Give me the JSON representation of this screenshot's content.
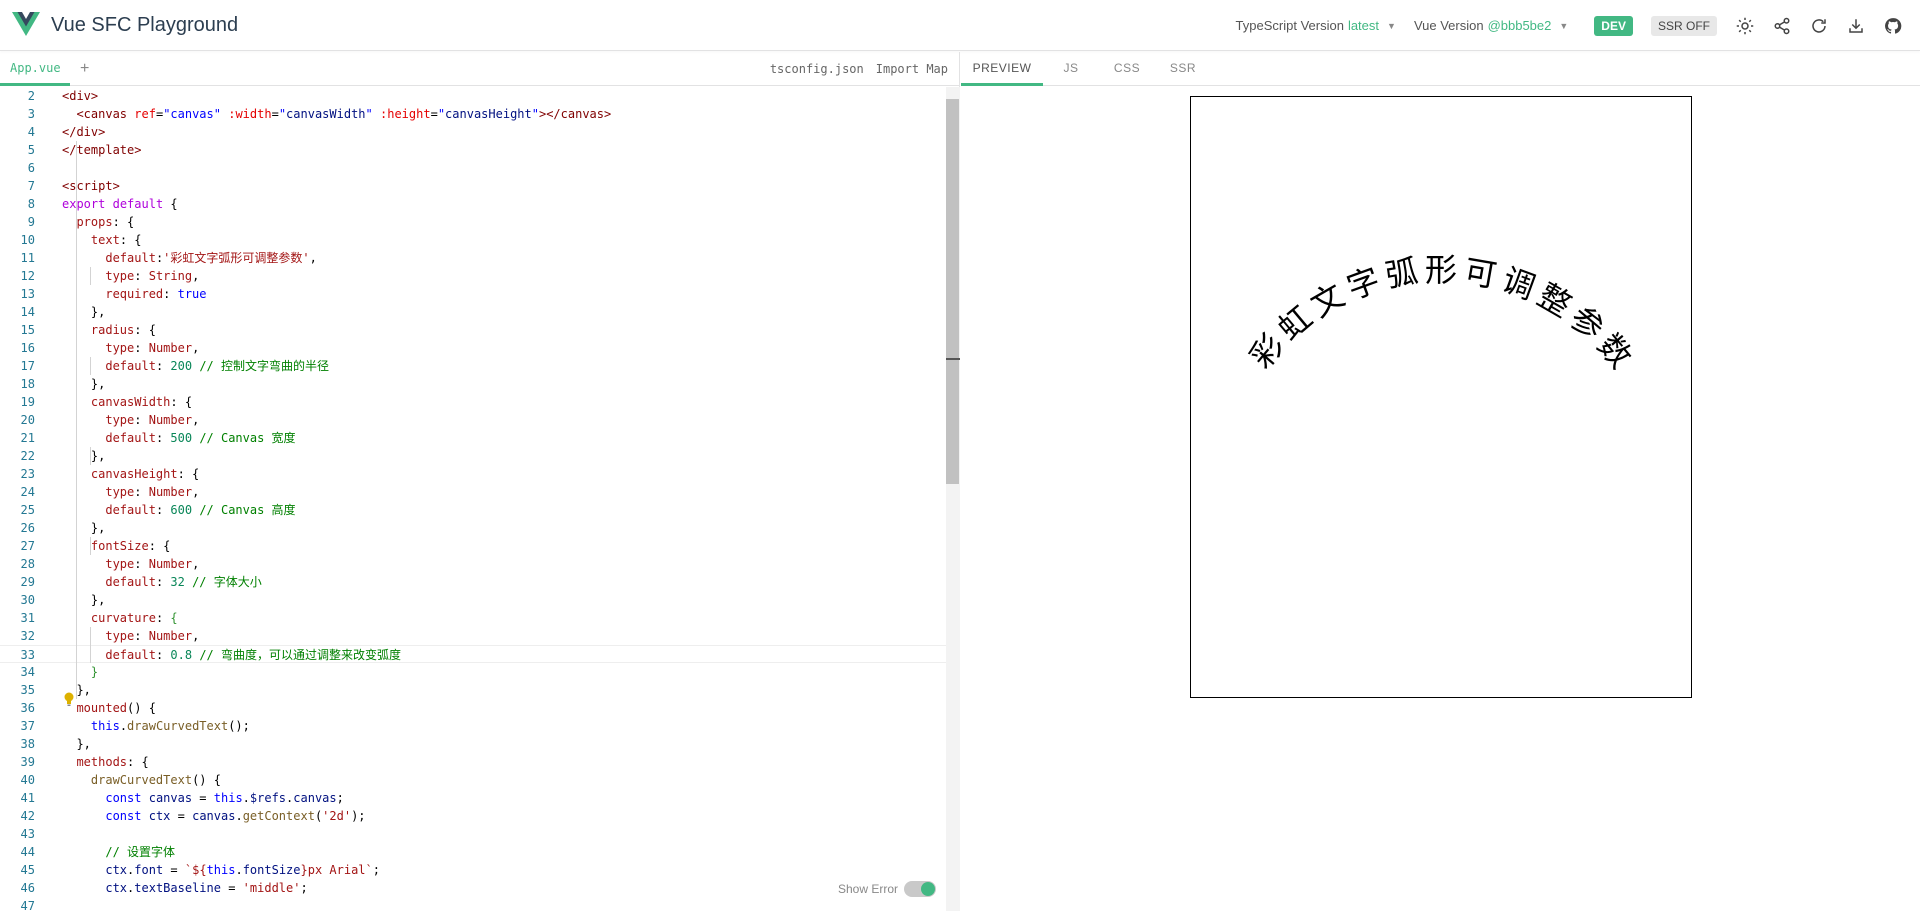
{
  "header": {
    "title": "Vue SFC Playground",
    "ts_label": "TypeScript Version",
    "ts_value": "latest",
    "vue_label": "Vue Version",
    "vue_value": "@bbb5be2",
    "dev_badge": "DEV",
    "ssr_badge": "SSR OFF",
    "icons": [
      "sun-icon",
      "share-icon",
      "reload-icon",
      "download-icon",
      "github-icon"
    ],
    "accent_color": "#42b883"
  },
  "editor": {
    "active_tab": "App.vue",
    "add_tab": "+",
    "right_tabs": [
      "tsconfig.json",
      "Import Map"
    ],
    "show_error_label": "Show Error",
    "lines": [
      {
        "n": "2",
        "html": "<span class=\"t-tag\">&lt;div&gt;</span>"
      },
      {
        "n": "3",
        "html": "  <span class=\"t-tag\">&lt;canvas</span> <span class=\"t-attr\">ref</span>=<span class=\"t-kw\">\"canvas\"</span> <span class=\"t-attr\">:width</span>=<span class=\"t-kw\">\"</span><span class=\"t-var\">canvasWidth</span><span class=\"t-kw\">\"</span> <span class=\"t-attr\">:height</span>=<span class=\"t-kw\">\"</span><span class=\"t-var\">canvasHeight</span><span class=\"t-kw\">\"</span><span class=\"t-tag\">&gt;&lt;/canvas&gt;</span>"
      },
      {
        "n": "4",
        "html": "<span class=\"t-tag\">&lt;/div&gt;</span>"
      },
      {
        "n": "5",
        "html": "<span class=\"t-tag\">&lt;/template&gt;</span>"
      },
      {
        "n": "6",
        "html": ""
      },
      {
        "n": "7",
        "html": "<span class=\"t-tag\">&lt;script&gt;</span>"
      },
      {
        "n": "8",
        "html": "<span class=\"t-key\">export</span> <span class=\"t-key\">default</span> {"
      },
      {
        "n": "9",
        "html": "  <span class=\"t-prop\">props</span>: {"
      },
      {
        "n": "10",
        "html": "    <span class=\"t-prop\">text</span>: {"
      },
      {
        "n": "11",
        "html": "      <span class=\"t-prop\">default</span>:<span class=\"t-str\">'彩虹文字弧形可调整参数'</span>,"
      },
      {
        "n": "12",
        "html": "      <span class=\"t-prop\">type</span>: <span class=\"t-prop\">String</span>,"
      },
      {
        "n": "13",
        "html": "      <span class=\"t-prop\">required</span>: <span class=\"t-kw\">true</span>"
      },
      {
        "n": "14",
        "html": "    },"
      },
      {
        "n": "15",
        "html": "    <span class=\"t-prop\">radius</span>: {"
      },
      {
        "n": "16",
        "html": "      <span class=\"t-prop\">type</span>: <span class=\"t-prop\">Number</span>,"
      },
      {
        "n": "17",
        "html": "      <span class=\"t-prop\">default</span>: <span class=\"t-num\">200</span> <span class=\"t-com\">// 控制文字弯曲的半径</span>"
      },
      {
        "n": "18",
        "html": "    },"
      },
      {
        "n": "19",
        "html": "    <span class=\"t-prop\">canvasWidth</span>: {"
      },
      {
        "n": "20",
        "html": "      <span class=\"t-prop\">type</span>: <span class=\"t-prop\">Number</span>,"
      },
      {
        "n": "21",
        "html": "      <span class=\"t-prop\">default</span>: <span class=\"t-num\">500</span> <span class=\"t-com\">// Canvas 宽度</span>"
      },
      {
        "n": "22",
        "html": "    },"
      },
      {
        "n": "23",
        "html": "    <span class=\"t-prop\">canvasHeight</span>: {"
      },
      {
        "n": "24",
        "html": "      <span class=\"t-prop\">type</span>: <span class=\"t-prop\">Number</span>,"
      },
      {
        "n": "25",
        "html": "      <span class=\"t-prop\">default</span>: <span class=\"t-num\">600</span> <span class=\"t-com\">// Canvas 高度</span>"
      },
      {
        "n": "26",
        "html": "    },"
      },
      {
        "n": "27",
        "html": "    <span class=\"t-prop\">fontSize</span>: {"
      },
      {
        "n": "28",
        "html": "      <span class=\"t-prop\">type</span>: <span class=\"t-prop\">Number</span>,"
      },
      {
        "n": "29",
        "html": "      <span class=\"t-prop\">default</span>: <span class=\"t-num\">32</span> <span class=\"t-com\">// 字体大小</span>"
      },
      {
        "n": "30",
        "html": "    },"
      },
      {
        "n": "31",
        "html": "    <span class=\"t-prop\">curvature</span>: <span class=\"t-br\">{</span>"
      },
      {
        "n": "32",
        "html": "      <span class=\"t-prop\">type</span>: <span class=\"t-prop\">Number</span>,"
      },
      {
        "n": "33",
        "html": "      <span class=\"t-prop\">default</span>: <span class=\"t-num\">0.8</span> <span class=\"t-com\">// 弯曲度，可以通过调整来改变弧度</span>"
      },
      {
        "n": "34",
        "html": "    <span class=\"t-br\">}</span>"
      },
      {
        "n": "35",
        "html": "  },"
      },
      {
        "n": "36",
        "html": "  <span class=\"t-prop\">mounted</span>() {"
      },
      {
        "n": "37",
        "html": "    <span class=\"t-kw\">this</span>.<span class=\"t-fn\">drawCurvedText</span>();"
      },
      {
        "n": "38",
        "html": "  },"
      },
      {
        "n": "39",
        "html": "  <span class=\"t-prop\">methods</span>: {"
      },
      {
        "n": "40",
        "html": "    <span class=\"t-fn\">drawCurvedText</span>() {"
      },
      {
        "n": "41",
        "html": "      <span class=\"t-kw\">const</span> <span class=\"t-var\">canvas</span> = <span class=\"t-kw\">this</span>.<span class=\"t-var\">$refs</span>.<span class=\"t-var\">canvas</span>;"
      },
      {
        "n": "42",
        "html": "      <span class=\"t-kw\">const</span> <span class=\"t-var\">ctx</span> = <span class=\"t-var\">canvas</span>.<span class=\"t-fn\">getContext</span>(<span class=\"t-str\">'2d'</span>);"
      },
      {
        "n": "43",
        "html": ""
      },
      {
        "n": "44",
        "html": "      <span class=\"t-com\">// 设置字体</span>"
      },
      {
        "n": "45",
        "html": "      <span class=\"t-var\">ctx</span>.<span class=\"t-var\">font</span> = <span class=\"t-str\">`${</span><span class=\"t-kw\">this</span>.<span class=\"t-var\">fontSize</span><span class=\"t-str\">}px Arial`</span>;"
      },
      {
        "n": "46",
        "html": "      <span class=\"t-var\">ctx</span>.<span class=\"t-var\">textBaseline</span> = <span class=\"t-str\">'middle'</span>;"
      },
      {
        "n": "47",
        "html": ""
      }
    ]
  },
  "preview": {
    "tabs": [
      "PREVIEW",
      "JS",
      "CSS",
      "SSR"
    ],
    "active_tab": "PREVIEW",
    "curved_text": "彩虹文字弧形可调整参数"
  }
}
